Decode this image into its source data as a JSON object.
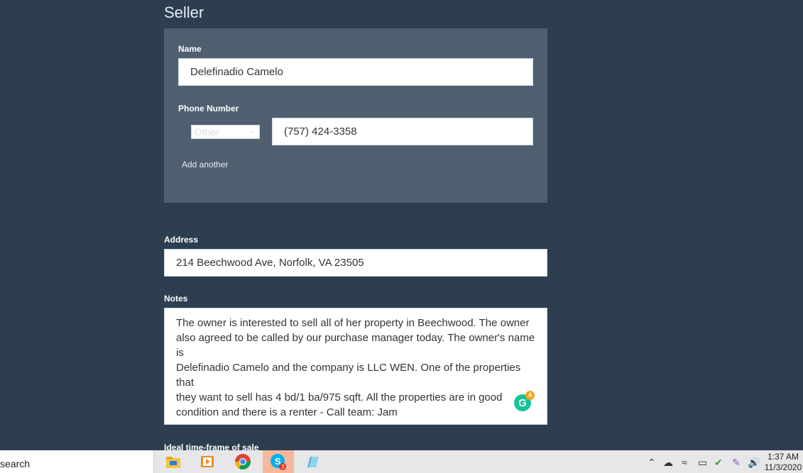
{
  "section_title": "Seller",
  "seller": {
    "name_label": "Name",
    "name_value": "Delefinadio Camelo",
    "phone_label": "Phone Number",
    "phone_type": "Other",
    "phone_value": "(757) 424-3358",
    "add_another": "Add another"
  },
  "address": {
    "label": "Address",
    "value": "214 Beechwood Ave, Norfolk, VA 23505"
  },
  "notes": {
    "label": "Notes",
    "lines": [
      "The owner is interested to sell all of her property in Beechwood. The owner",
      "also agreed to be called by our purchase manager today.  The owner's name is",
      "Delefinadio Camelo and the company is LLC WEN. One of the properties that",
      "they want to sell has 4 bd/1 ba/975 sqft. All the properties are in good",
      "condition and there is a renter - Call team: Jam"
    ],
    "grammarly_icon": "grammarly-icon",
    "grammarly_count": "4"
  },
  "next_field_label": "Ideal time-frame of sale",
  "taskbar": {
    "search_text": "search",
    "apps": [
      "file-explorer-icon",
      "media-player-icon",
      "chrome-icon",
      "skype-icon",
      "notepad-icon"
    ],
    "skype_badge": "3",
    "time": "1:37 AM",
    "date": "11/3/2020"
  },
  "colors": {
    "background": "#2c3e50",
    "panel": "#4f5f70",
    "grammarly": "#15c39a"
  }
}
